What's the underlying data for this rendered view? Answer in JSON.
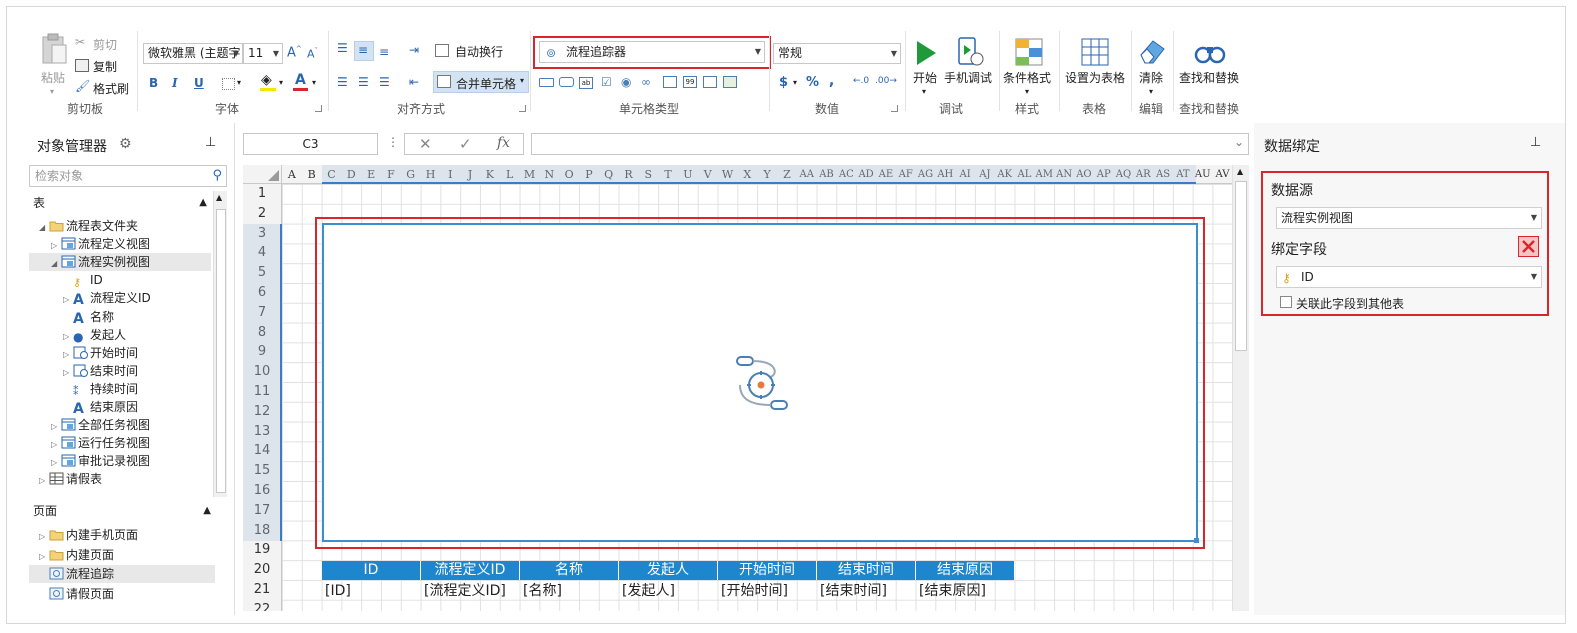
{
  "ribbon": {
    "clipboard": {
      "paste": "粘贴",
      "cut": "剪切",
      "copy": "复制",
      "format_painter": "格式刷",
      "label": "剪切板"
    },
    "font": {
      "family": "微软雅黑 (主题字",
      "size": "11",
      "bold": "B",
      "italic": "I",
      "underline": "U",
      "font_color_letter": "A",
      "label": "字体"
    },
    "alignment": {
      "wrap": "自动换行",
      "merge": "合并单元格",
      "label": "对齐方式"
    },
    "celltype": {
      "selected": "流程追踪器",
      "label": "单元格类型"
    },
    "number": {
      "format": "常规",
      "currency": "$",
      "percent": "%",
      "comma": ",",
      "label": "数值"
    },
    "debug": {
      "start": "开始",
      "mobile_debug": "手机调试",
      "label": "调试"
    },
    "style": {
      "conditional": "条件格式",
      "label": "样式"
    },
    "table": {
      "set_as_table": "设置为表格",
      "label": "表格"
    },
    "edit": {
      "clear": "清除",
      "label": "编辑"
    },
    "find": {
      "find_replace": "查找和替换",
      "label": "查找和替换"
    }
  },
  "object_manager": {
    "title": "对象管理器",
    "search_placeholder": "检索对象",
    "tables_header": "表",
    "tables": [
      {
        "label": "流程表文件夹",
        "level": 0,
        "expanded": true,
        "icon": "folder-icon"
      },
      {
        "label": "流程定义视图",
        "level": 1,
        "expanded": false,
        "icon": "view-icon"
      },
      {
        "label": "流程实例视图",
        "level": 1,
        "expanded": true,
        "icon": "view-icon",
        "selected": true
      },
      {
        "label": "ID",
        "level": 2,
        "icon": "key-field-icon"
      },
      {
        "label": "流程定义ID",
        "level": 2,
        "expandable": true,
        "icon": "text-field-icon"
      },
      {
        "label": "名称",
        "level": 2,
        "icon": "text-field-icon"
      },
      {
        "label": "发起人",
        "level": 2,
        "expandable": true,
        "icon": "user-field-icon"
      },
      {
        "label": "开始时间",
        "level": 2,
        "expandable": true,
        "icon": "datetime-field-icon"
      },
      {
        "label": "结束时间",
        "level": 2,
        "expandable": true,
        "icon": "datetime-field-icon"
      },
      {
        "label": "持续时间",
        "level": 2,
        "icon": "duration-field-icon"
      },
      {
        "label": "结束原因",
        "level": 2,
        "icon": "text-field-icon"
      },
      {
        "label": "全部任务视图",
        "level": 1,
        "expanded": false,
        "icon": "view-icon"
      },
      {
        "label": "运行任务视图",
        "level": 1,
        "expanded": false,
        "icon": "view-icon"
      },
      {
        "label": "审批记录视图",
        "level": 1,
        "expanded": false,
        "icon": "view-icon"
      },
      {
        "label": "请假表",
        "level": 0,
        "expanded": false,
        "icon": "table-icon"
      }
    ],
    "pages_header": "页面",
    "pages": [
      {
        "label": "内建手机页面",
        "expandable": true,
        "icon": "folder-icon"
      },
      {
        "label": "内建页面",
        "expandable": true,
        "icon": "folder-icon"
      },
      {
        "label": "流程追踪",
        "icon": "page-icon",
        "selected": true
      },
      {
        "label": "请假页面",
        "icon": "page-icon"
      }
    ]
  },
  "formula_bar": {
    "cell_ref": "C3",
    "cancel": "✕",
    "confirm": "✓",
    "fx": "fx",
    "value": ""
  },
  "sheet": {
    "columns": [
      "A",
      "B",
      "C",
      "D",
      "E",
      "F",
      "G",
      "H",
      "I",
      "J",
      "K",
      "L",
      "M",
      "N",
      "O",
      "P",
      "Q",
      "R",
      "S",
      "T",
      "U",
      "V",
      "W",
      "X",
      "Y",
      "Z",
      "AA",
      "AB",
      "AC",
      "AD",
      "AE",
      "AF",
      "AG",
      "AH",
      "AI",
      "AJ",
      "AK",
      "AL",
      "AM",
      "AN",
      "AO",
      "AP",
      "AQ",
      "AR",
      "AS",
      "AT",
      "AU",
      "AV"
    ],
    "rows": [
      "1",
      "2",
      "3",
      "4",
      "5",
      "6",
      "7",
      "8",
      "9",
      "10",
      "11",
      "12",
      "13",
      "14",
      "15",
      "16",
      "17",
      "18",
      "19",
      "20",
      "21",
      "22"
    ],
    "table_headers": [
      "ID",
      "流程定义ID",
      "名称",
      "发起人",
      "开始时间",
      "结束时间",
      "结束原因"
    ],
    "table_cells": [
      "[ID]",
      "[流程定义ID]",
      "[名称]",
      "[发起人]",
      "[开始时间]",
      "[结束时间]",
      "[结束原因]"
    ]
  },
  "data_binding": {
    "title": "数据绑定",
    "source_label": "数据源",
    "source_value": "流程实例视图",
    "field_label": "绑定字段",
    "field_value": "ID",
    "link_checkbox": "关联此字段到其他表"
  },
  "colors": {
    "accent": "#1e86cc",
    "highlight": "#d9262c",
    "header_fill": "#f3f3f3"
  }
}
